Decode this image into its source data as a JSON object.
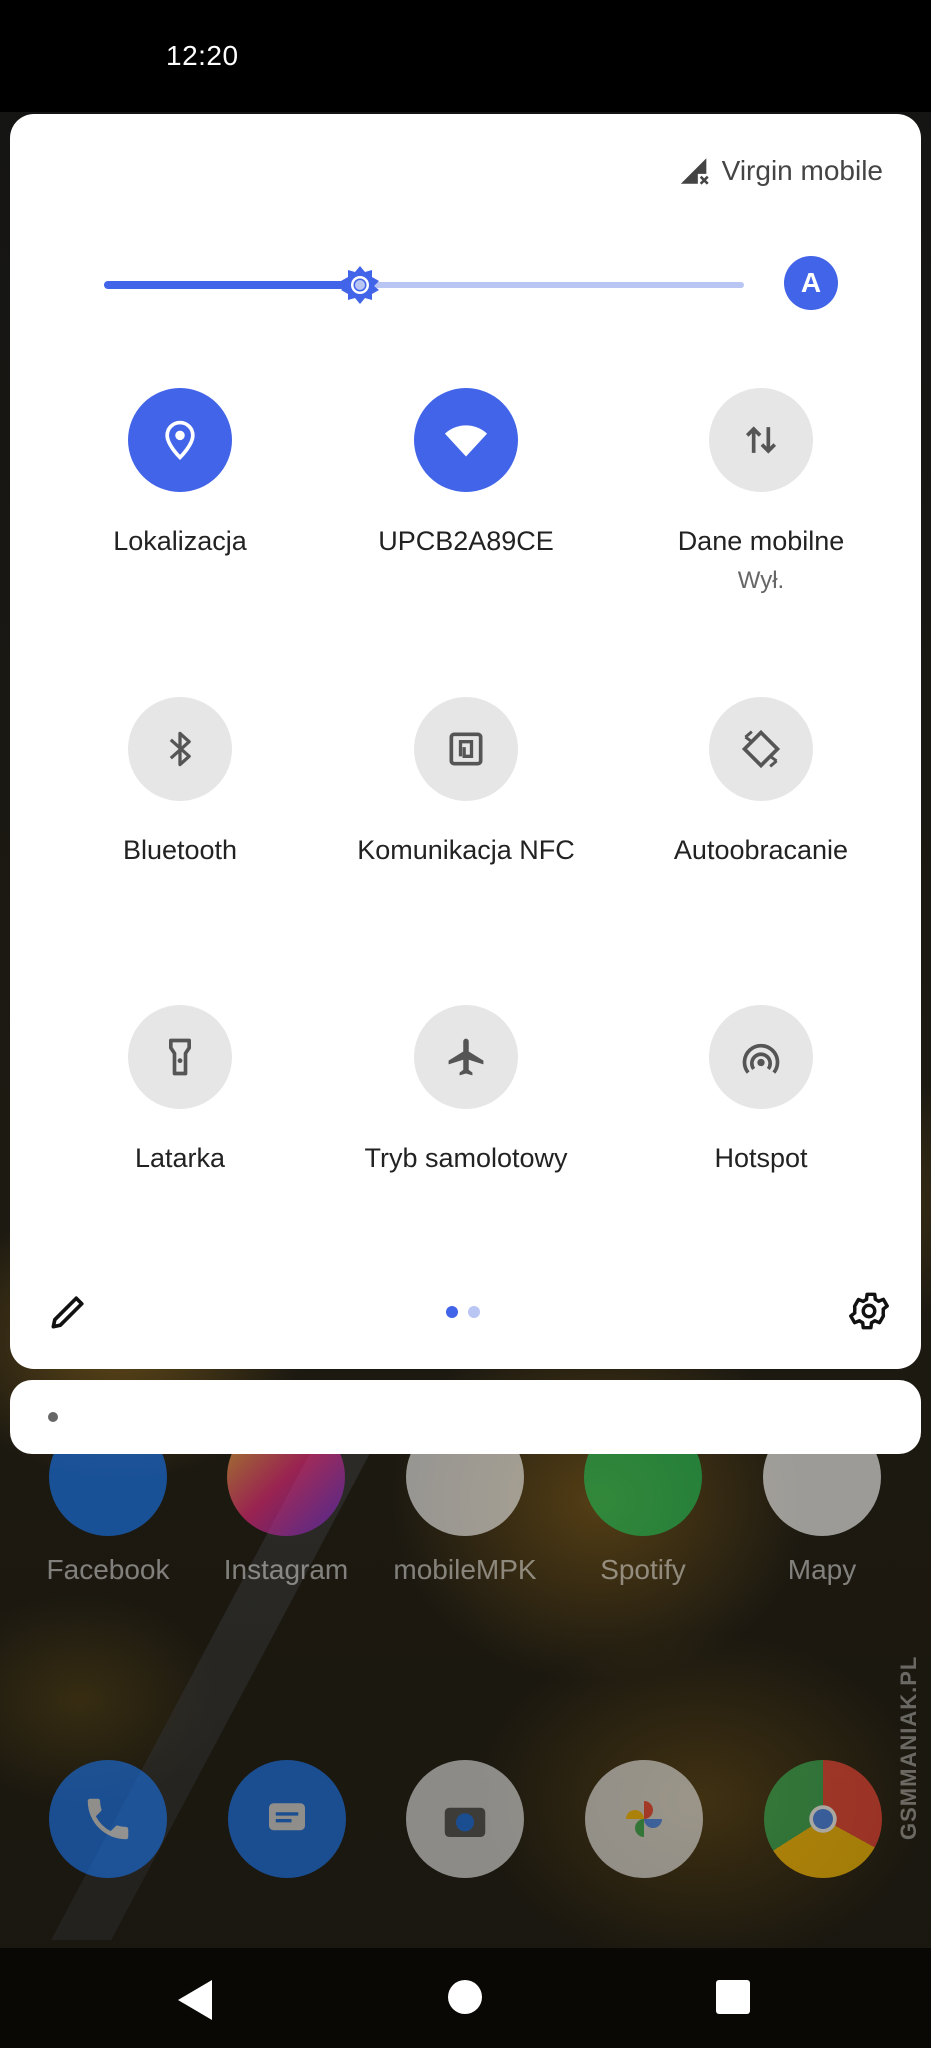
{
  "status_bar": {
    "time": "12:20"
  },
  "quick_settings": {
    "carrier": "Virgin mobile",
    "brightness_level": 0.4,
    "auto_brightness_label": "A",
    "accent_color": "#4264e8",
    "tiles": [
      {
        "label": "Lokalizacja",
        "state": "on",
        "icon": "location-icon"
      },
      {
        "label": "UPCB2A89CE",
        "state": "on",
        "icon": "wifi-icon"
      },
      {
        "label": "Dane mobilne",
        "sublabel": "Wył.",
        "state": "off",
        "icon": "mobile-data-icon"
      },
      {
        "label": "Bluetooth",
        "state": "off",
        "icon": "bluetooth-icon"
      },
      {
        "label": "Komunikacja NFC",
        "state": "off",
        "icon": "nfc-icon"
      },
      {
        "label": "Autoobracanie",
        "state": "off",
        "icon": "auto-rotate-icon"
      },
      {
        "label": "Latarka",
        "state": "off",
        "icon": "flashlight-icon"
      },
      {
        "label": "Tryb samolotowy",
        "state": "off",
        "icon": "airplane-icon"
      },
      {
        "label": "Hotspot",
        "state": "off",
        "icon": "hotspot-icon"
      }
    ],
    "page_indicator": {
      "current": 1,
      "total": 2
    }
  },
  "home": {
    "apps": [
      "Facebook",
      "Instagram",
      "mobileMPK",
      "Spotify",
      "Mapy"
    ],
    "dock": [
      "phone-icon",
      "messages-icon",
      "camera-icon",
      "photos-icon",
      "chrome-icon"
    ]
  },
  "watermark": "GSMMANIAK.PL"
}
